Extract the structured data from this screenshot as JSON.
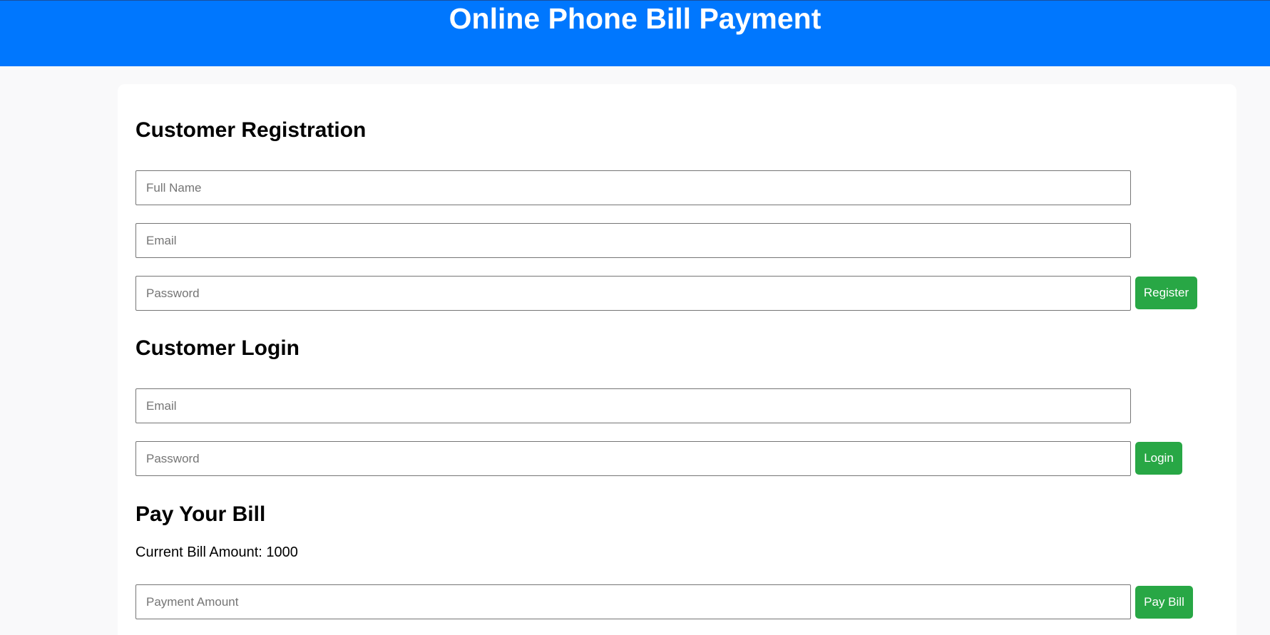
{
  "header": {
    "title": "Online Phone Bill Payment"
  },
  "registration": {
    "heading": "Customer Registration",
    "full_name_placeholder": "Full Name",
    "email_placeholder": "Email",
    "password_placeholder": "Password",
    "register_label": "Register"
  },
  "login": {
    "heading": "Customer Login",
    "email_placeholder": "Email",
    "password_placeholder": "Password",
    "login_label": "Login"
  },
  "bill": {
    "heading": "Pay Your Bill",
    "current_amount_text": "Current Bill Amount: 1000",
    "payment_placeholder": "Payment Amount",
    "pay_label": "Pay Bill"
  },
  "colors": {
    "header_bg": "#0077fe",
    "button_bg": "#28a745",
    "page_bg": "#f9f9fa"
  }
}
